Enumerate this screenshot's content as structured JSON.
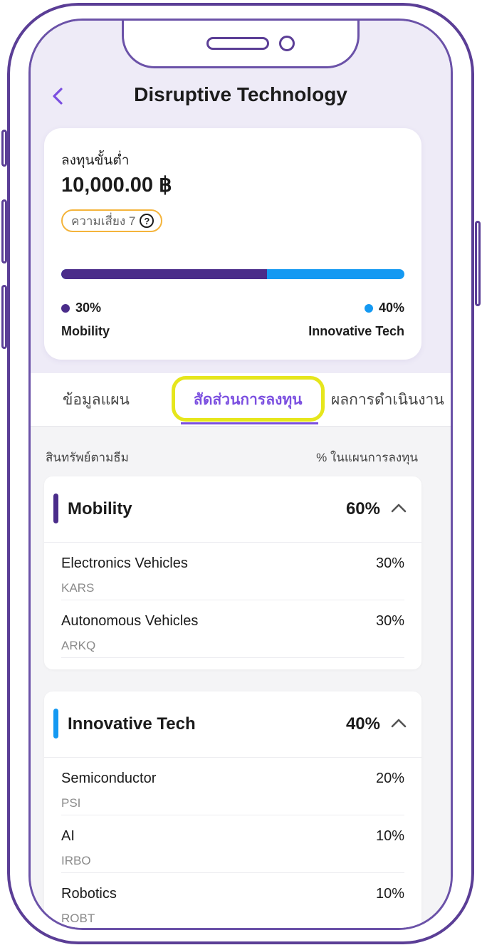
{
  "header": {
    "title": "Disruptive Technology",
    "back_icon": "chevron-left-icon"
  },
  "summary": {
    "min_invest_label": "ลงทุนขั้นต่ำ",
    "min_invest_value": "10,000.00 ฿",
    "risk_label": "ความเสี่ยง 7",
    "allocation_bar": {
      "first_fraction": 0.6,
      "first_color": "#4a2c8a",
      "second_color": "#1499f2"
    },
    "legend": [
      {
        "percent": "30%",
        "name": "Mobility",
        "color": "#4a2c8a"
      },
      {
        "percent": "40%",
        "name": "Innovative Tech",
        "color": "#1499f2"
      }
    ]
  },
  "tabs": [
    {
      "label": "ข้อมูลแผน",
      "active": false
    },
    {
      "label": "สัดส่วนการลงทุน",
      "active": true
    },
    {
      "label": "ผลการดำเนินงาน",
      "active": false
    }
  ],
  "list_header": {
    "left": "สินทรัพย์ตามธีม",
    "right": "% ในแผนการลงทุน"
  },
  "groups": [
    {
      "title": "Mobility",
      "percent": "60%",
      "accent": "#4a2c8a",
      "items": [
        {
          "name": "Electronics Vehicles",
          "code": "KARS",
          "percent": "30%"
        },
        {
          "name": "Autonomous Vehicles",
          "code": "ARKQ",
          "percent": "30%"
        }
      ]
    },
    {
      "title": "Innovative Tech",
      "percent": "40%",
      "accent": "#1499f2",
      "items": [
        {
          "name": "Semiconductor",
          "code": "PSI",
          "percent": "20%"
        },
        {
          "name": "AI",
          "code": "IRBO",
          "percent": "10%"
        },
        {
          "name": "Robotics",
          "code": "ROBT",
          "percent": "10%"
        }
      ]
    }
  ],
  "colors": {
    "accent_purple": "#7b4fe0",
    "brand_dark": "#4a2c8a",
    "brand_blue": "#1499f2",
    "highlight": "#e6e61c",
    "risk_border": "#f4b43b"
  }
}
